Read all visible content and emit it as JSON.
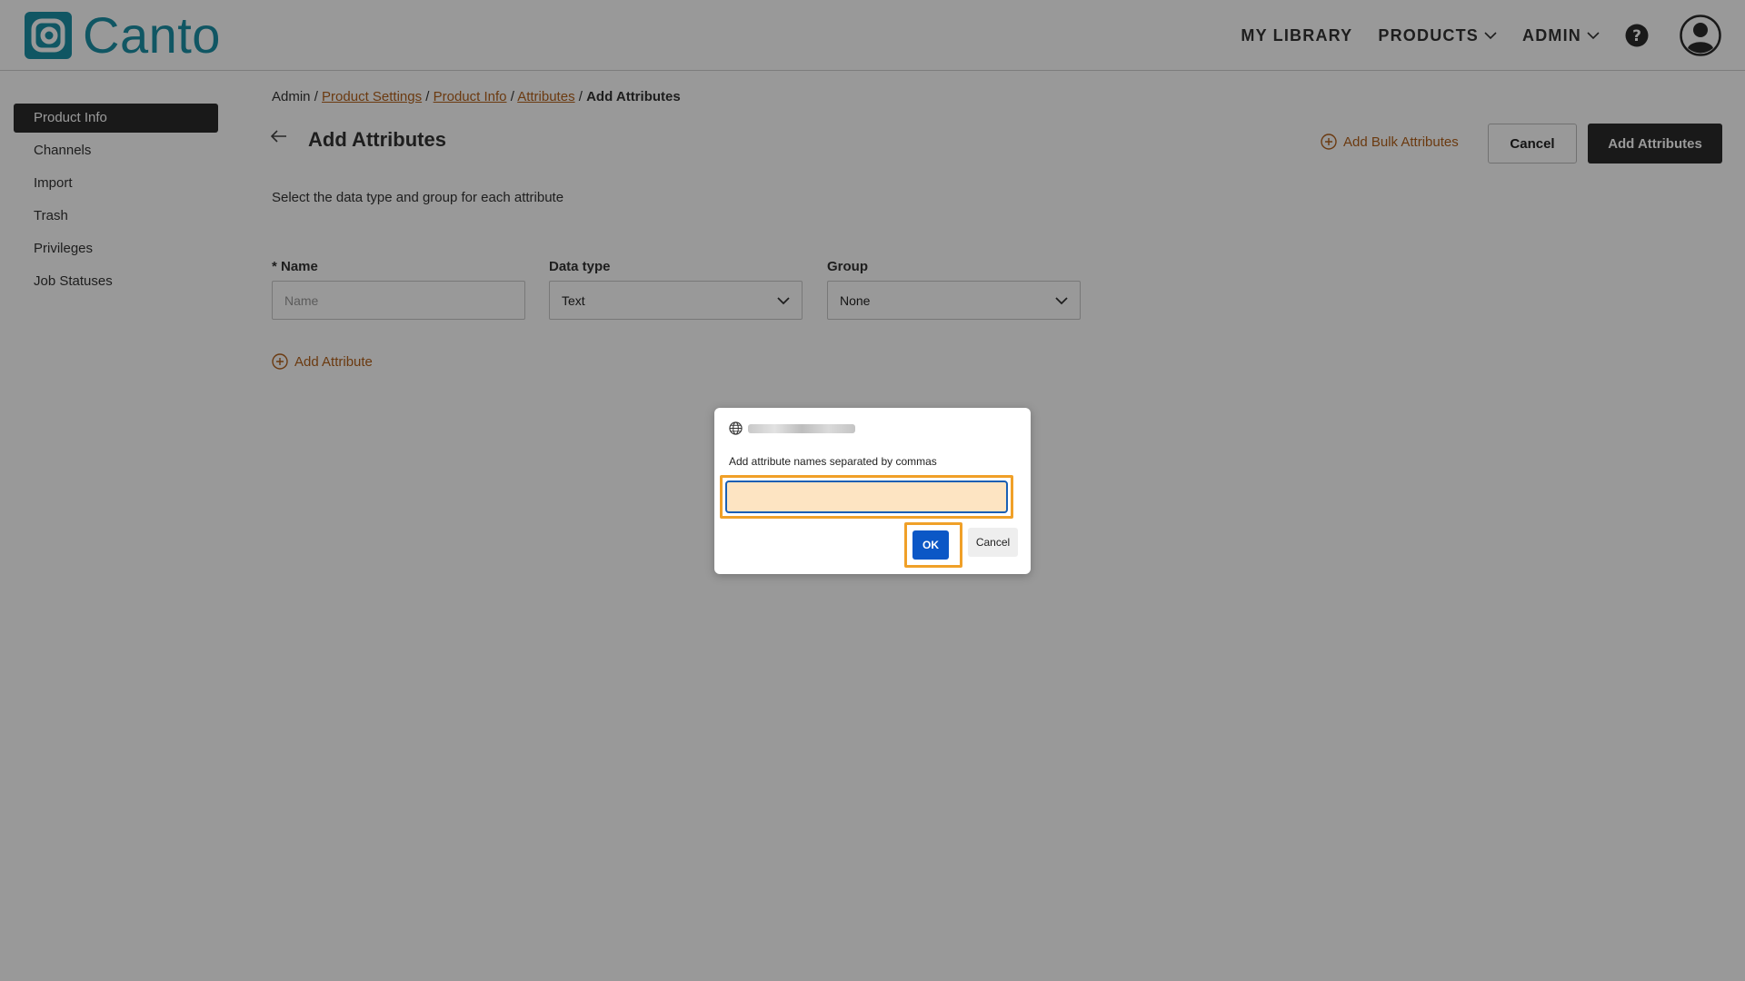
{
  "brand": {
    "name": "Canto",
    "color": "#1b8fa6"
  },
  "header": {
    "nav": [
      {
        "label": "MY LIBRARY",
        "has_dropdown": false
      },
      {
        "label": "PRODUCTS",
        "has_dropdown": true
      },
      {
        "label": "ADMIN",
        "has_dropdown": true
      }
    ],
    "help_icon": "question-circle-icon",
    "user_icon": "user-avatar-icon"
  },
  "sidebar": {
    "items": [
      {
        "label": "Product Info",
        "active": true
      },
      {
        "label": "Channels"
      },
      {
        "label": "Import"
      },
      {
        "label": "Trash"
      },
      {
        "label": "Privileges"
      },
      {
        "label": "Job Statuses"
      }
    ]
  },
  "breadcrumb": {
    "root": "Admin",
    "sep": "/",
    "links": [
      "Product Settings",
      "Product Info",
      "Attributes"
    ],
    "current": "Add Attributes"
  },
  "page": {
    "title": "Add Attributes",
    "subtitle": "Select the data type and group for each attribute",
    "bulk_link": "Add Bulk Attributes",
    "cancel_button": "Cancel",
    "add_button": "Add Attributes",
    "add_attribute_link": "Add Attribute",
    "accent_color": "#b3611c"
  },
  "form": {
    "name": {
      "label": "* Name",
      "placeholder": "Name",
      "value": ""
    },
    "data_type": {
      "label": "Data type",
      "value": "Text"
    },
    "group": {
      "label": "Group",
      "value": "None"
    }
  },
  "dialog": {
    "origin_icon": "globe-icon",
    "message": "Add attribute names separated by commas",
    "input_value": "",
    "ok_label": "OK",
    "cancel_label": "Cancel",
    "highlight_color": "#f0a028",
    "ok_color": "#0b57c6"
  }
}
